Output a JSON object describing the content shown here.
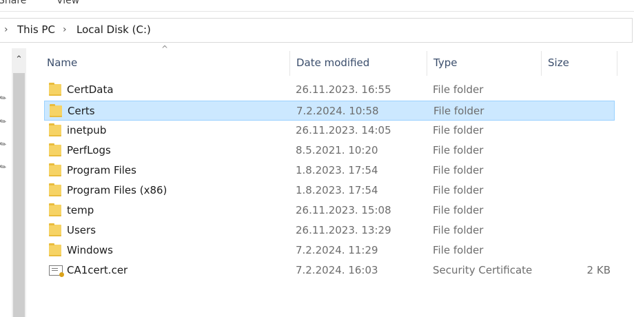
{
  "ribbon": {
    "tabs": [
      "Share",
      "View"
    ]
  },
  "breadcrumb": [
    "This PC",
    "Local Disk (C:)"
  ],
  "columns": {
    "name": "Name",
    "date": "Date modified",
    "type": "Type",
    "size": "Size"
  },
  "files": [
    {
      "name": "CertData",
      "date": "26.11.2023. 16:55",
      "type": "File folder",
      "size": "",
      "icon": "folder-icon"
    },
    {
      "name": "Certs",
      "date": "7.2.2024. 10:58",
      "type": "File folder",
      "size": "",
      "icon": "folder-icon",
      "selected": true
    },
    {
      "name": "inetpub",
      "date": "26.11.2023. 14:05",
      "type": "File folder",
      "size": "",
      "icon": "folder-icon"
    },
    {
      "name": "PerfLogs",
      "date": "8.5.2021. 10:20",
      "type": "File folder",
      "size": "",
      "icon": "folder-icon"
    },
    {
      "name": "Program Files",
      "date": "1.8.2023. 17:54",
      "type": "File folder",
      "size": "",
      "icon": "folder-icon"
    },
    {
      "name": "Program Files (x86)",
      "date": "1.8.2023. 17:54",
      "type": "File folder",
      "size": "",
      "icon": "folder-icon"
    },
    {
      "name": "temp",
      "date": "26.11.2023. 15:08",
      "type": "File folder",
      "size": "",
      "icon": "folder-icon"
    },
    {
      "name": "Users",
      "date": "26.11.2023. 13:29",
      "type": "File folder",
      "size": "",
      "icon": "folder-icon"
    },
    {
      "name": "Windows",
      "date": "7.2.2024. 11:29",
      "type": "File folder",
      "size": "",
      "icon": "folder-icon"
    },
    {
      "name": "CA1cert.cer",
      "date": "7.2.2024. 16:03",
      "type": "Security Certificate",
      "size": "2 KB",
      "icon": "certificate-file-icon"
    }
  ],
  "colors": {
    "selection": "#cce8ff",
    "selection_border": "#99d1ff",
    "header_text": "#3a4d6b",
    "folder": "#f6d365"
  }
}
